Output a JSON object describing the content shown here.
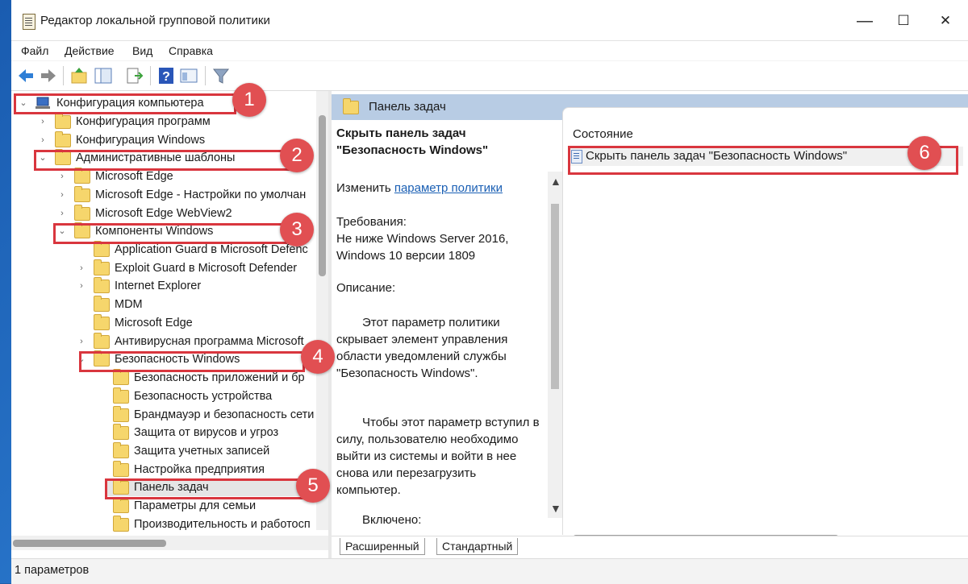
{
  "window": {
    "title": "Редактор локальной групповой политики",
    "minimize": "—",
    "maximize": "☐",
    "close": "✕"
  },
  "menu": [
    "Файл",
    "Действие",
    "Вид",
    "Справка"
  ],
  "tree": [
    {
      "label": "Конфигурация компьютера",
      "chev": "⌄"
    },
    {
      "label": "Конфигурация программ",
      "chev": "›"
    },
    {
      "label": "Конфигурация Windows",
      "chev": "›"
    },
    {
      "label": "Административные шаблоны",
      "chev": "⌄"
    },
    {
      "label": "Microsoft Edge",
      "chev": "›"
    },
    {
      "label": "Microsoft Edge - Настройки по умолчан",
      "chev": "›"
    },
    {
      "label": "Microsoft Edge WebView2",
      "chev": "›"
    },
    {
      "label": "Компоненты Windows",
      "chev": "⌄"
    },
    {
      "label": "Application Guard в Microsoft Defenc",
      "chev": ""
    },
    {
      "label": "Exploit Guard в Microsoft Defender",
      "chev": "›"
    },
    {
      "label": "Internet Explorer",
      "chev": "›"
    },
    {
      "label": "MDM",
      "chev": ""
    },
    {
      "label": "Microsoft Edge",
      "chev": ""
    },
    {
      "label": "Антивирусная программа Microsoft",
      "chev": "›"
    },
    {
      "label": "Безопасность Windows",
      "chev": "⌄"
    },
    {
      "label": "Безопасность приложений и бр",
      "chev": ""
    },
    {
      "label": "Безопасность устройства",
      "chev": ""
    },
    {
      "label": "Брандмауэр и безопасность сети",
      "chev": ""
    },
    {
      "label": "Защита от вирусов и угроз",
      "chev": ""
    },
    {
      "label": "Защита учетных записей",
      "chev": ""
    },
    {
      "label": "Настройка предприятия",
      "chev": ""
    },
    {
      "label": "Панель задач",
      "chev": ""
    },
    {
      "label": "Параметры для семьи",
      "chev": ""
    },
    {
      "label": "Производительность и работосп",
      "chev": ""
    }
  ],
  "right_header": "Панель задач",
  "description": {
    "title": "Скрыть панель задач \"Безопасность Windows\"",
    "edit_prefix": "Изменить",
    "edit_link": "параметр политики",
    "requirements_label": "Требования:",
    "requirements_text": "Не ниже Windows Server 2016, Windows 10 версии 1809",
    "description_label": "Описание:",
    "paragraph1": "Этот параметр политики скрывает элемент управления области уведомлений службы \"Безопасность Windows\".",
    "paragraph2": "Чтобы этот параметр вступил в силу, пользователю необходимо выйти из системы и войти в нее снова или перезагрузить компьютер.",
    "enabled_label": "Включено:"
  },
  "settings": {
    "column_header": "Состояние",
    "row": "Скрыть панель задач \"Безопасность Windows\""
  },
  "tabs": [
    "Расширенный",
    "Стандартный"
  ],
  "status": "1 параметров",
  "badges": [
    "1",
    "2",
    "3",
    "4",
    "5",
    "6"
  ],
  "colors": {
    "highlight": "#d9363e",
    "badge": "#e14f52",
    "header": "#b8cce4",
    "link": "#1a5fb4"
  }
}
